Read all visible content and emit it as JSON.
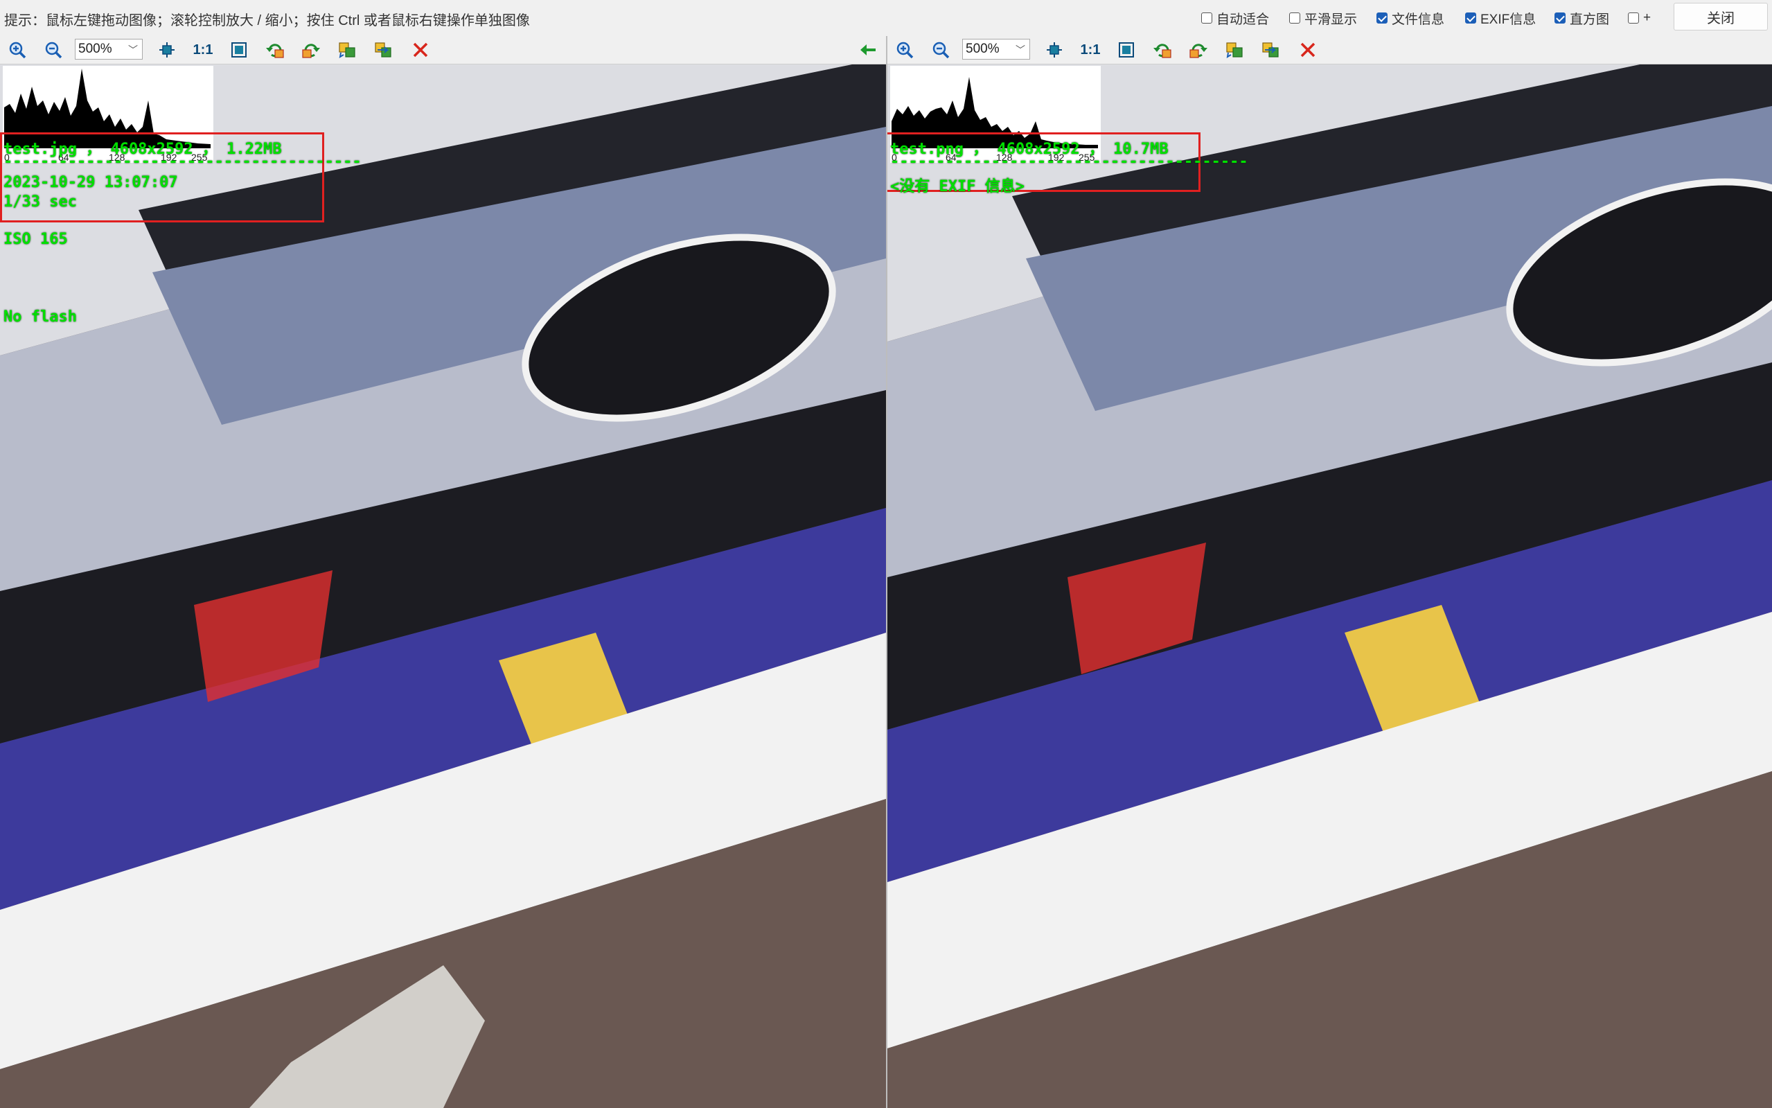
{
  "hint_bar": {
    "text": "提示：鼠标左键拖动图像；滚轮控制放大 / 缩小；按住 Ctrl 或者鼠标右键操作单独图像"
  },
  "options": [
    {
      "label": "自动适合",
      "checked": false
    },
    {
      "label": "平滑显示",
      "checked": false
    },
    {
      "label": "文件信息",
      "checked": true
    },
    {
      "label": "EXIF信息",
      "checked": true
    },
    {
      "label": "直方图",
      "checked": true
    },
    {
      "label": "+",
      "checked": false
    }
  ],
  "close_label": "关闭",
  "toolbar": {
    "zoom_value": "500%",
    "one_to_one": "1:1",
    "icons": [
      "zoom-in-icon",
      "zoom-out-icon",
      "fit-icon",
      "one-to-one-icon",
      "fullscreen-icon",
      "rotate-left-icon",
      "rotate-right-icon",
      "flip-h-icon",
      "flip-v-icon",
      "close-image-icon"
    ],
    "sync_arrow_icon": "arrow-left-icon"
  },
  "colors": {
    "info_text": "#00e000",
    "info_box": "#e02020",
    "toolbar_bg": "#f0f0f0"
  },
  "left": {
    "histogram_ticks": [
      "0",
      "64",
      "128",
      "192",
      "255"
    ],
    "file_line": "test.jpg ， 4608x2592 ， 1.22MB",
    "separator": "---------------------------------------",
    "datetime": "2023-10-29 13:07:07",
    "exposure": "1/33 sec",
    "iso": "ISO 165",
    "flash": "No flash"
  },
  "right": {
    "histogram_ticks": [
      "0",
      "64",
      "128",
      "192",
      "255"
    ],
    "file_line": "test.png ， 4608x2592 ， 10.7MB",
    "separator": "---------------------------------------",
    "exif_none": "<没有 EXIF 信息>"
  }
}
